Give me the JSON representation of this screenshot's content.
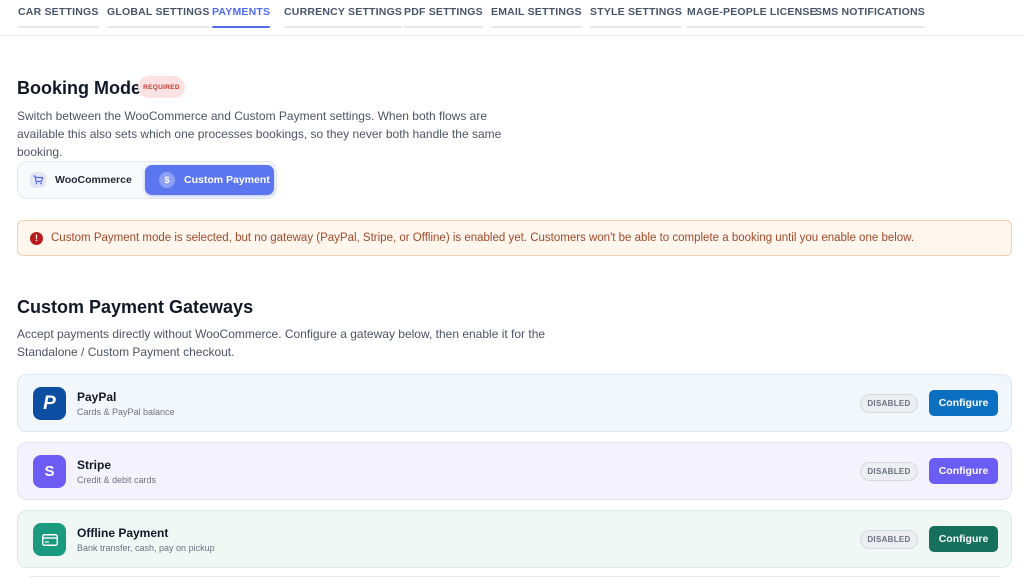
{
  "tabs": [
    {
      "label": "CAR SETTINGS",
      "active": false
    },
    {
      "label": "GLOBAL SETTINGS",
      "active": false
    },
    {
      "label": "PAYMENTS",
      "active": true
    },
    {
      "label": "CURRENCY SETTINGS",
      "active": false
    },
    {
      "label": "PDF SETTINGS",
      "active": false
    },
    {
      "label": "EMAIL SETTINGS",
      "active": false
    },
    {
      "label": "STYLE SETTINGS",
      "active": false
    },
    {
      "label": "MAGE-PEOPLE LICENSE",
      "active": false
    },
    {
      "label": "SMS NOTIFICATIONS",
      "active": false
    }
  ],
  "booking_mode": {
    "title": "Booking Mode",
    "badge": "REQUIRED",
    "desc_lines": [
      "Switch between the WooCommerce and Custom Payment settings. When both flows are",
      "available this also sets which one processes bookings, so they never both handle the same",
      "booking."
    ],
    "options": [
      {
        "label": "WooCommerce",
        "icon": "cart-icon",
        "selected": false
      },
      {
        "label": "Custom Payment",
        "icon": "dollar-circle-icon",
        "selected": true
      }
    ]
  },
  "alert": {
    "icon": "exclamation-circle-icon",
    "text": "Custom Payment mode is selected, but no gateway (PayPal, Stripe, or Offline) is enabled yet. Customers won't be able to complete a booking until you enable one below."
  },
  "gateways_section": {
    "title": "Custom Payment Gateways",
    "desc_lines": [
      "Accept payments directly without WooCommerce. Configure a gateway below, then enable it for the",
      "Standalone / Custom Payment checkout."
    ]
  },
  "gateways": [
    {
      "name": "PayPal",
      "subtitle": "Cards & PayPal balance",
      "status": "DISABLED",
      "button": "Configure",
      "logo_glyph": "P",
      "icon": "paypal-logo-icon",
      "color": "#0b6fc2"
    },
    {
      "name": "Stripe",
      "subtitle": "Credit & debit cards",
      "status": "DISABLED",
      "button": "Configure",
      "logo_glyph": "S",
      "icon": "stripe-logo-icon",
      "color": "#6b5cf6"
    },
    {
      "name": "Offline Payment",
      "subtitle": "Bank transfer, cash, pay on pickup",
      "status": "DISABLED",
      "button": "Configure",
      "icon": "credit-card-icon",
      "color": "#16705b"
    }
  ]
}
